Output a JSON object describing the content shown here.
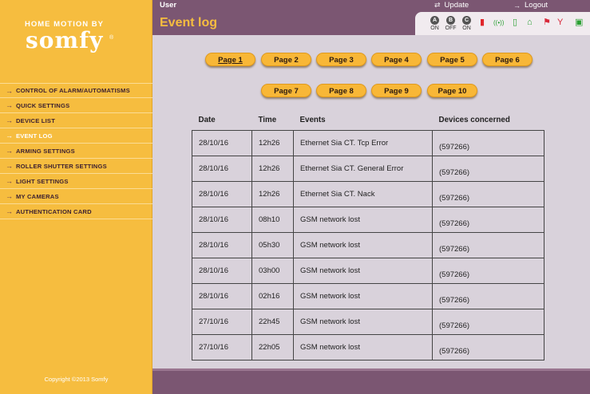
{
  "brand": {
    "tagline": "HOME MOTION BY",
    "logo": "somfy",
    "reg": "®"
  },
  "sidebar": {
    "items": [
      {
        "label": "CONTROL OF ALARM/AUTOMATISMS",
        "active": false
      },
      {
        "label": "QUICK SETTINGS",
        "active": false
      },
      {
        "label": "DEVICE LIST",
        "active": false
      },
      {
        "label": "EVENT LOG",
        "active": true
      },
      {
        "label": "ARMING SETTINGS",
        "active": false
      },
      {
        "label": "ROLLER SHUTTER SETTINGS",
        "active": false
      },
      {
        "label": "LIGHT SETTINGS",
        "active": false
      },
      {
        "label": "MY CAMERAS",
        "active": false
      },
      {
        "label": "AUTHENTICATION CARD",
        "active": false
      }
    ],
    "arrow": "→",
    "copyright": "Copyright ©2013 Somfy"
  },
  "topbar": {
    "user": "User",
    "update": "Update",
    "logout": "Logout",
    "update_icon": "⇄",
    "logout_icon": "→"
  },
  "title": "Event log",
  "status": {
    "zones": [
      {
        "letter": "A",
        "state": "ON"
      },
      {
        "letter": "B",
        "state": "OFF"
      },
      {
        "letter": "C",
        "state": "ON"
      }
    ],
    "icons": [
      {
        "name": "battery-icon",
        "glyph": "▮",
        "color": "#e0262a"
      },
      {
        "name": "radio-signal-icon",
        "glyph": "((•))",
        "color": "#2aa033"
      },
      {
        "name": "phone-icon",
        "glyph": "▯",
        "color": "#2aa033"
      },
      {
        "name": "house-icon",
        "glyph": "⌂",
        "color": "#2aa033"
      },
      {
        "name": "tamper-flag-icon",
        "glyph": "⚑",
        "color": "#d8283a"
      },
      {
        "name": "gsm-antenna-icon",
        "glyph": "Y",
        "color": "#d8283a"
      },
      {
        "name": "box-icon",
        "glyph": "▣",
        "color": "#2aa033"
      }
    ]
  },
  "pagination": {
    "row1": [
      "Page 1",
      "Page 2",
      "Page 3",
      "Page 4",
      "Page 5",
      "Page 6"
    ],
    "row2": [
      "Page 7",
      "Page 8",
      "Page 9",
      "Page 10"
    ],
    "current": "Page 1"
  },
  "table": {
    "headers": {
      "date": "Date",
      "time": "Time",
      "events": "Events",
      "devices": "Devices concerned"
    },
    "rows": [
      {
        "date": "28/10/16",
        "time": "12h26",
        "event": "Ethernet Sia CT. Tcp Error",
        "device": "(597266)"
      },
      {
        "date": "28/10/16",
        "time": "12h26",
        "event": "Ethernet Sia CT. General Error",
        "device": "(597266)"
      },
      {
        "date": "28/10/16",
        "time": "12h26",
        "event": "Ethernet Sia CT. Nack",
        "device": "(597266)"
      },
      {
        "date": "28/10/16",
        "time": "08h10",
        "event": "GSM network lost",
        "device": "(597266)"
      },
      {
        "date": "28/10/16",
        "time": "05h30",
        "event": "GSM network lost",
        "device": "(597266)"
      },
      {
        "date": "28/10/16",
        "time": "03h00",
        "event": "GSM network lost",
        "device": "(597266)"
      },
      {
        "date": "28/10/16",
        "time": "02h16",
        "event": "GSM network lost",
        "device": "(597266)"
      },
      {
        "date": "27/10/16",
        "time": "22h45",
        "event": "GSM network lost",
        "device": "(597266)"
      },
      {
        "date": "27/10/16",
        "time": "22h05",
        "event": "GSM network lost",
        "device": "(597266)"
      }
    ]
  },
  "colors": {
    "sidebar": "#f6bd3f",
    "header": "#7b5672",
    "content": "#d9d2db",
    "button": "#f8b737"
  }
}
